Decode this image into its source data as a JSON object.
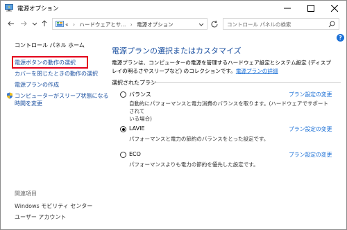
{
  "window": {
    "title": "電源オプション"
  },
  "navbar": {
    "crumbs": [
      "«",
      "ハードウェアとサ...",
      "電源オプション"
    ],
    "search_placeholder": "コントロール パネルの検索"
  },
  "left": {
    "home": "コントロール パネル ホーム",
    "links": [
      "電源ボタンの動作の選択",
      "カバーを閉じたときの動作の選択",
      "電源プランの作成",
      "コンピューターがスリープ状態になる",
      "時間を変更"
    ],
    "related_title": "関連項目",
    "related": [
      "Windows モビリティ センター",
      "ユーザー アカウント"
    ]
  },
  "main": {
    "title": "電源プランの選択またはカスタマイズ",
    "desc_line1": "電源プランは、コンピューターの電源を管理するハードウェア設定とシステム設定 (ディスプ",
    "desc_line2": "レイの明るさやスリープなど) のコレクションです。",
    "desc_link": "電源プランの詳細",
    "section": "選択されたプラン",
    "plans": [
      {
        "name": "バランス",
        "selected": false,
        "link": "プラン設定の変更",
        "desc1": "自動的にパフォーマンスと電力消費のバランスを取ります。(ハードウェアでサポートされて",
        "desc2": "いる場合)"
      },
      {
        "name": "LAVIE",
        "selected": true,
        "link": "プラン設定の変更",
        "desc1": "パフォーマンスと電力の節約のバランスをとった設定です。",
        "desc2": ""
      },
      {
        "name": "ECO",
        "selected": false,
        "link": "プラン設定の変更",
        "desc1": "パフォーマンスよりも電力の節約を優先した設定です。",
        "desc2": ""
      }
    ]
  },
  "help_label": "?"
}
